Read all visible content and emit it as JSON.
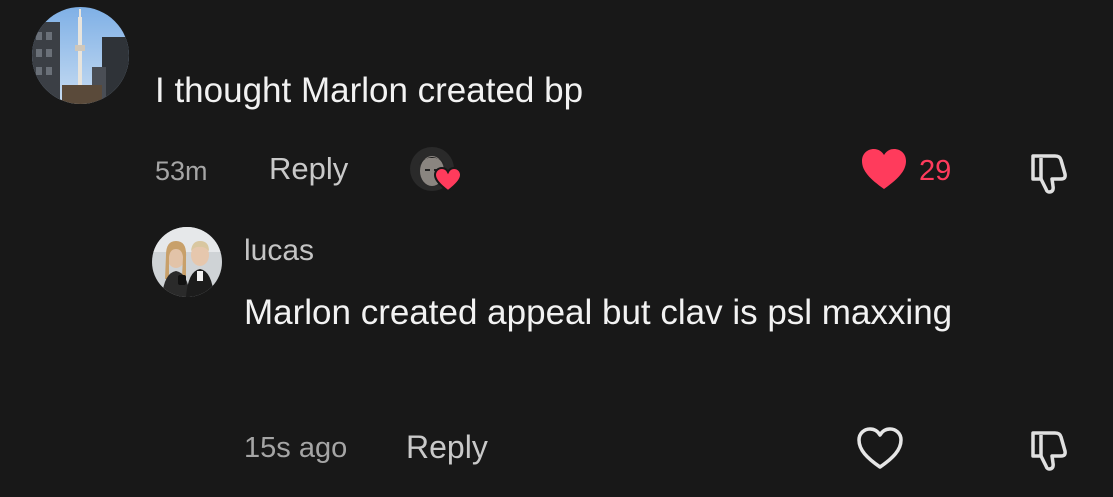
{
  "comments": [
    {
      "text": "I thought Marlon created bp",
      "time": "53m",
      "reply_label": "Reply",
      "like_count": "29",
      "liked": true,
      "liked_by_creator": true,
      "avatar_icon": "tower-photo-avatar",
      "like_icon": "heart-filled-icon",
      "dislike_icon": "thumbs-down-icon"
    },
    {
      "username": "lucas",
      "text": "Marlon created appeal but clav is psl maxxing",
      "time": "15s ago",
      "reply_label": "Reply",
      "liked": false,
      "avatar_icon": "couple-photo-avatar",
      "like_icon": "heart-outline-icon",
      "dislike_icon": "thumbs-down-icon"
    }
  ],
  "colors": {
    "background": "#181818",
    "like_red": "#ff3b5c",
    "text_primary": "#f2f2f2",
    "text_secondary": "#a5a5a5"
  }
}
